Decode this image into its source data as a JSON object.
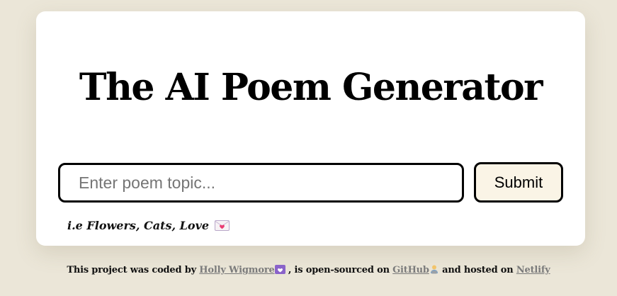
{
  "page": {
    "title": "The AI Poem Generator"
  },
  "form": {
    "input_placeholder": "Enter poem topic...",
    "input_value": "",
    "submit_label": "Submit",
    "hint_text": "i.e Flowers, Cats, Love"
  },
  "footer": {
    "part1": "This project was coded by",
    "author_link": "Holly Wigmore",
    "part2": ", is open-sourced on",
    "github_link": "GitHub",
    "part3": "and hosted on",
    "netlify_link": "Netlify"
  },
  "icons": {
    "hint_icon": "love-letter-icon",
    "author_icon": "purple-heart-icon",
    "github_icon": "technologist-icon"
  },
  "colors": {
    "background": "#ebe6d8",
    "card": "#ffffff",
    "submit_bg": "#faf4e6",
    "link": "#7b7b7b"
  }
}
